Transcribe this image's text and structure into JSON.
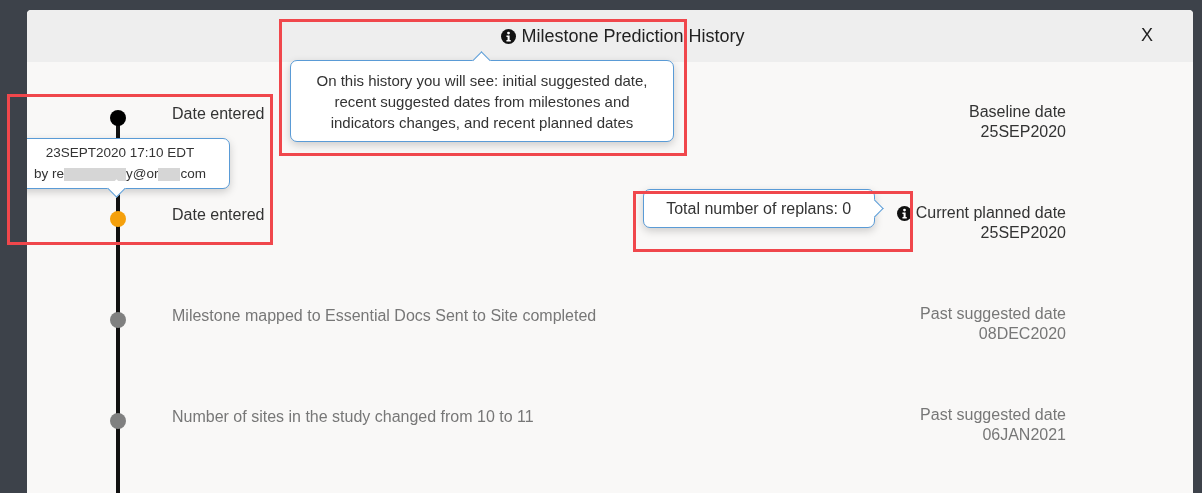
{
  "dialog": {
    "title": "Milestone Prediction History",
    "close": "X",
    "title_tooltip": "On this history you will see: initial suggested date, recent suggested dates from milestones and indicators changes, and recent planned dates"
  },
  "entries": [
    {
      "kind": "entered",
      "color": "#000000",
      "description": "Date entered",
      "date_label": "Baseline date",
      "date": "25SEP2020"
    },
    {
      "kind": "entered",
      "color": "#f5a00c",
      "description": "Date entered",
      "date_label": "Current planned date",
      "date": "25SEP2020",
      "info_tooltip": "Total number of replans: 0",
      "stamp": {
        "time": "23SEPT2020 17:10 EDT",
        "email_parts": [
          "by re",
          "y@or",
          "com"
        ]
      }
    },
    {
      "kind": "suggested",
      "color": "#808080",
      "description": "Milestone mapped to Essential Docs Sent to Site completed",
      "date_label": "Past suggested date",
      "date": "08DEC2020"
    },
    {
      "kind": "suggested",
      "color": "#808080",
      "description": "Number of sites in the study changed from 10 to 11",
      "date_label": "Past suggested date",
      "date": "06JAN2021"
    }
  ]
}
